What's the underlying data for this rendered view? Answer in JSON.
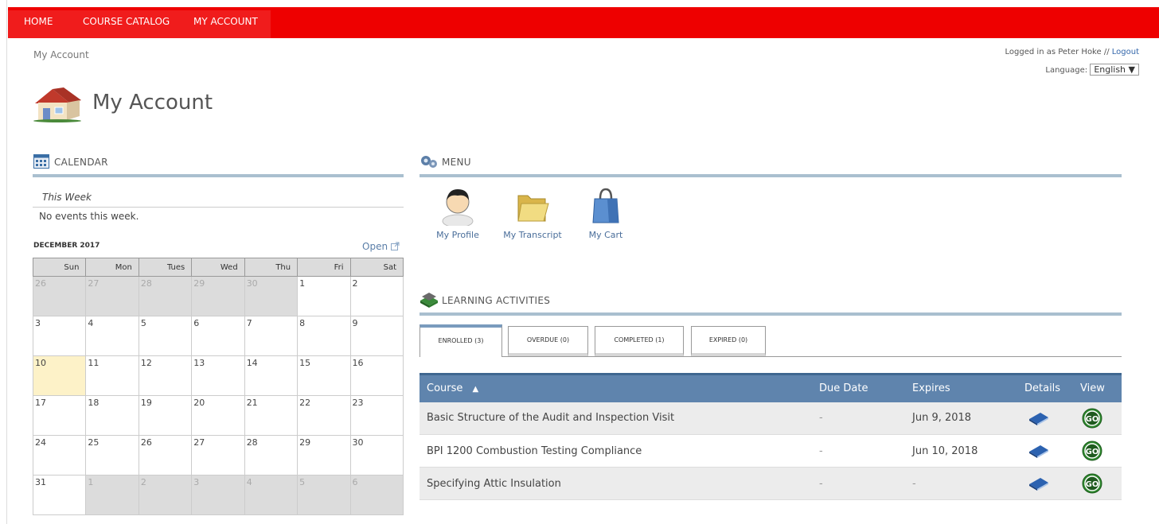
{
  "nav": {
    "home": "HOME",
    "catalog": "COURSE CATALOG",
    "account": "MY ACCOUNT"
  },
  "breadcrumb": "My Account",
  "login": {
    "prefix": "Logged in as Peter Hoke //",
    "logout": "Logout"
  },
  "language": {
    "label": "Language:",
    "value": "English ▼"
  },
  "page_title": "My Account",
  "calendar": {
    "heading": "CALENDAR",
    "this_week": "This Week",
    "no_events": "No events this week.",
    "month": "DECEMBER 2017",
    "open": "Open",
    "days": [
      "Sun",
      "Mon",
      "Tues",
      "Wed",
      "Thu",
      "Fri",
      "Sat"
    ],
    "weeks": [
      [
        "26",
        "27",
        "28",
        "29",
        "30",
        "1",
        "2"
      ],
      [
        "3",
        "4",
        "5",
        "6",
        "7",
        "8",
        "9"
      ],
      [
        "10",
        "11",
        "12",
        "13",
        "14",
        "15",
        "16"
      ],
      [
        "17",
        "18",
        "19",
        "20",
        "21",
        "22",
        "23"
      ],
      [
        "24",
        "25",
        "26",
        "27",
        "28",
        "29",
        "30"
      ],
      [
        "31",
        "1",
        "2",
        "3",
        "4",
        "5",
        "6"
      ]
    ]
  },
  "menu": {
    "heading": "MENU",
    "items": [
      "My Profile",
      "My Transcript",
      "My Cart"
    ]
  },
  "learning": {
    "heading": "LEARNING ACTIVITIES",
    "tabs": [
      "ENROLLED (3)",
      "OVERDUE (0)",
      "COMPLETED (1)",
      "EXPIRED (0)"
    ],
    "columns": {
      "course": "Course",
      "sort": "▲",
      "due": "Due Date",
      "expires": "Expires",
      "details": "Details",
      "view": "View"
    },
    "rows": [
      {
        "course": "Basic Structure of the Audit and Inspection Visit",
        "due": "-",
        "expires": "Jun 9, 2018"
      },
      {
        "course": "BPI 1200 Combustion Testing Compliance",
        "due": "-",
        "expires": "Jun 10, 2018"
      },
      {
        "course": "Specifying Attic Insulation",
        "due": "-",
        "expires": "-"
      }
    ],
    "go_label": "GO"
  },
  "colors": {
    "nav": "#ee0000",
    "accent": "#5f84ad",
    "rule": "#a9bfcf",
    "today": "#fdf2c8"
  }
}
